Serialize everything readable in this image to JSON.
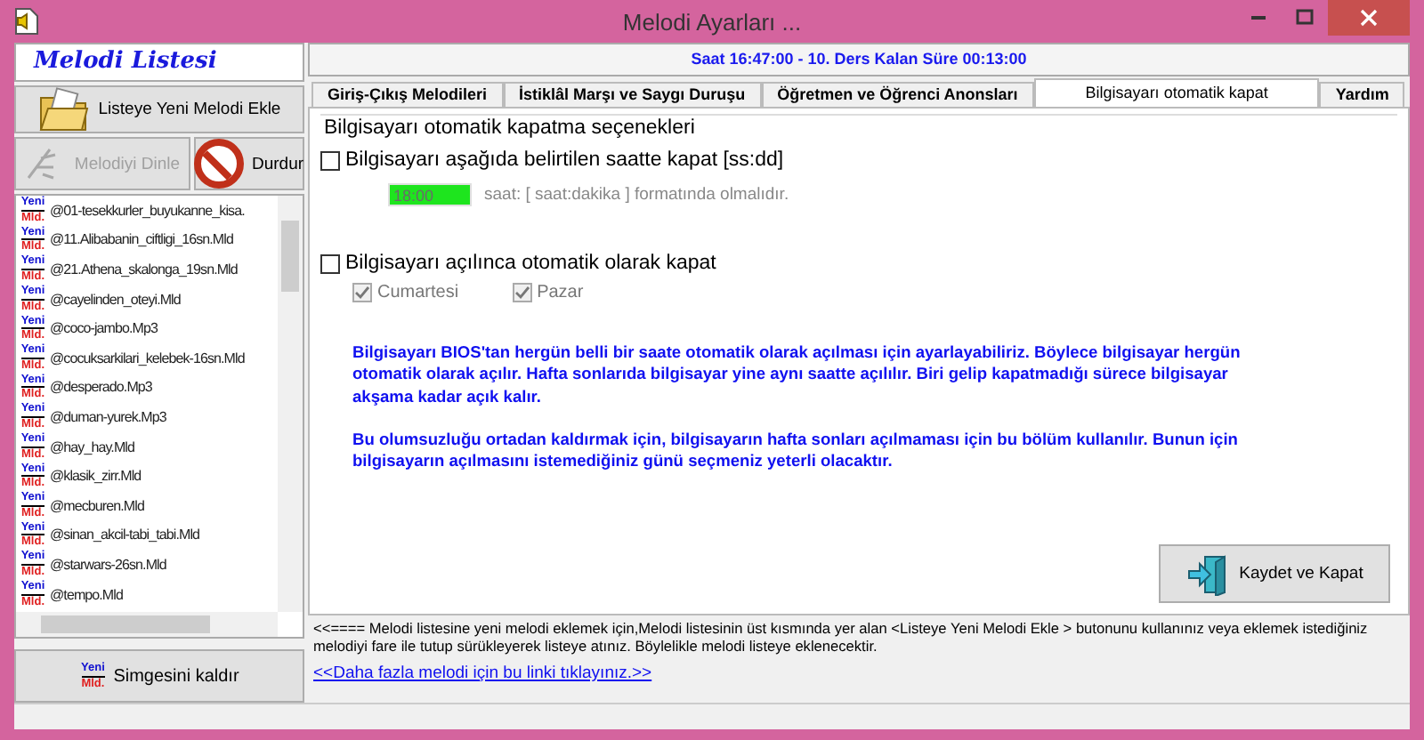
{
  "window": {
    "title": "Melodi  Ayarları ..."
  },
  "sidebar": {
    "title": "Melodi Listesi",
    "add_button": "Listeye Yeni Melodi Ekle",
    "play_button": {
      "label": "Melodiyi  Dinle",
      "disabled": true
    },
    "stop_button": {
      "label": "Durdur",
      "disabled": false
    },
    "items": [
      {
        "badge_top": "Yeni",
        "badge_bottom": "Mld.",
        "name": "@01-tesekkurler_buyukanne_kisa."
      },
      {
        "badge_top": "Yeni",
        "badge_bottom": "Mld.",
        "name": "@11.Alibabanin_ciftligi_16sn.Mld"
      },
      {
        "badge_top": "Yeni",
        "badge_bottom": "Mld.",
        "name": "@21.Athena_skalonga_19sn.Mld"
      },
      {
        "badge_top": "Yeni",
        "badge_bottom": "Mld.",
        "name": "@cayelinden_oteyi.Mld"
      },
      {
        "badge_top": "Yeni",
        "badge_bottom": "Mld.",
        "name": "@coco-jambo.Mp3"
      },
      {
        "badge_top": "Yeni",
        "badge_bottom": "Mld.",
        "name": "@cocuksarkilari_kelebek-16sn.Mld"
      },
      {
        "badge_top": "Yeni",
        "badge_bottom": "Mld.",
        "name": "@desperado.Mp3"
      },
      {
        "badge_top": "Yeni",
        "badge_bottom": "Mld.",
        "name": "@duman-yurek.Mp3"
      },
      {
        "badge_top": "Yeni",
        "badge_bottom": "Mld.",
        "name": "@hay_hay.Mld"
      },
      {
        "badge_top": "Yeni",
        "badge_bottom": "Mld.",
        "name": "@klasik_zirr.Mld"
      },
      {
        "badge_top": "Yeni",
        "badge_bottom": "Mld.",
        "name": "@mecburen.Mld"
      },
      {
        "badge_top": "Yeni",
        "badge_bottom": "Mld.",
        "name": "@sinan_akcil-tabi_tabi.Mld"
      },
      {
        "badge_top": "Yeni",
        "badge_bottom": "Mld.",
        "name": "@starwars-26sn.Mld"
      },
      {
        "badge_top": "Yeni",
        "badge_bottom": "Mld.",
        "name": "@tempo.Mld"
      }
    ],
    "remove_button": {
      "badge_top": "Yeni",
      "badge_bottom": "Mld.",
      "label": "Simgesini kaldır"
    }
  },
  "status": "Saat  16:47:00  -  10. Ders Kalan Süre 00:13:00",
  "tabs": [
    {
      "label": "Giriş-Çıkış Melodileri",
      "selected": false
    },
    {
      "label": "İstiklâl Marşı ve Saygı Duruşu",
      "selected": false
    },
    {
      "label": "Öğretmen ve Öğrenci Anonsları",
      "selected": false
    },
    {
      "label": "Bilgisayarı otomatik kapat",
      "selected": true
    },
    {
      "label": "Yardım",
      "selected": false
    }
  ],
  "panel": {
    "group_title": "Bilgisayarı otomatik kapatma  seçenekleri",
    "time_option": {
      "label": "Bilgisayarı aşağıda belirtilen saatte kapat [ss:dd]",
      "checked": false
    },
    "time_field": {
      "value": "18:00",
      "disabled": true
    },
    "time_hint": "saat: [ saat:dakika ] formatında olmalıdır.",
    "startup_option": {
      "label": "Bilgisayarı açılınca otomatik olarak kapat",
      "checked": false
    },
    "days": [
      {
        "label": "Cumartesi",
        "checked": true,
        "disabled": true
      },
      {
        "label": "Pazar",
        "checked": true,
        "disabled": true
      }
    ],
    "paragraphs": [
      "Bilgisayarı BIOS'tan hergün belli bir saate otomatik olarak açılması için ayarlayabiliriz. Böylece bilgisayar hergün otomatik olarak açılır. Hafta sonlarıda bilgisayar yine aynı saatte açılılır. Biri gelip kapatmadığı sürece bilgisayar akşama kadar açık kalır.",
      "Bu olumsuzluğu ortadan kaldırmak için, bilgisayarın hafta sonları açılmaması için bu bölüm kullanılır.  Bunun için bilgisayarın açılmasını istemediğiniz günü seçmeniz yeterli olacaktır."
    ],
    "save_button": "Kaydet ve Kapat"
  },
  "footer": {
    "note": "<<====     Melodi listesine yeni melodi eklemek için,Melodi listesinin üst kısmında yer alan  <Listeye Yeni Melodi Ekle > butonunu kullanınız veya eklemek istediğiniz melodiyi  fare ile tutup sürükleyerek listeye atınız.  Böylelikle melodi listeye eklenecektir.",
    "link": "<<Daha fazla melodi için bu linki tıklayınız.>>"
  }
}
